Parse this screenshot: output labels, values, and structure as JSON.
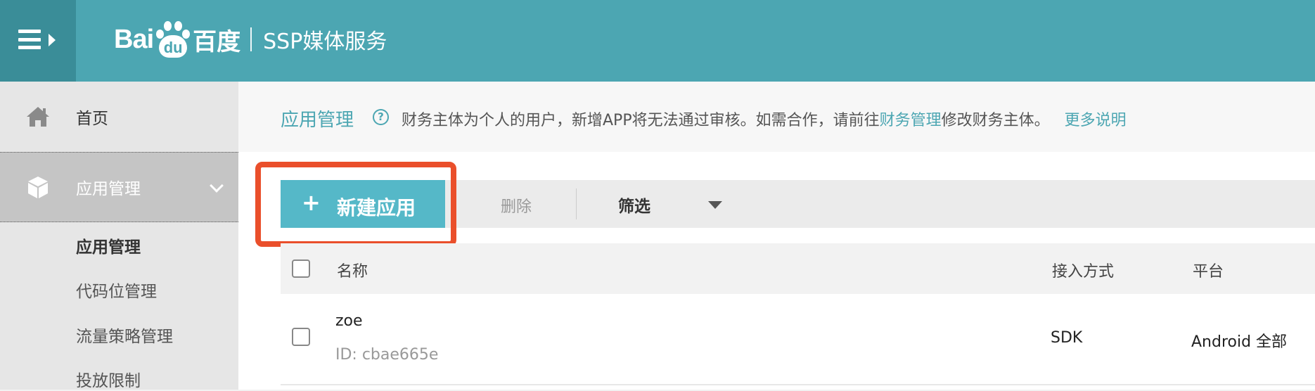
{
  "header": {
    "logo_latin": "Bai",
    "logo_paw_text": "du",
    "logo_cn": "百度",
    "product": "SSP媒体服务"
  },
  "sidebar": {
    "home_label": "首页",
    "app_group_label": "应用管理",
    "sub_items": [
      "应用管理",
      "代码位管理",
      "流量策略管理",
      "投放限制"
    ]
  },
  "main": {
    "title": "应用管理",
    "notice_pre": "财务主体为个人的用户，新增APP将无法通过审核。如需合作，请前往",
    "notice_link": "财务管理",
    "notice_post": "修改财务主体。",
    "more_link": "更多说明",
    "toolbar": {
      "new_app_label": "新建应用",
      "delete_label": "删除",
      "filter_label": "筛选"
    },
    "table": {
      "columns": [
        "名称",
        "接入方式",
        "平台"
      ],
      "rows": [
        {
          "name": "zoe",
          "id": "ID: cbae665e",
          "access": "SDK",
          "platform": "Android 全部"
        }
      ]
    }
  },
  "colors": {
    "header_bg": "#4ca6b2",
    "accent": "#55b8c8",
    "highlight": "#ea4f2b"
  }
}
